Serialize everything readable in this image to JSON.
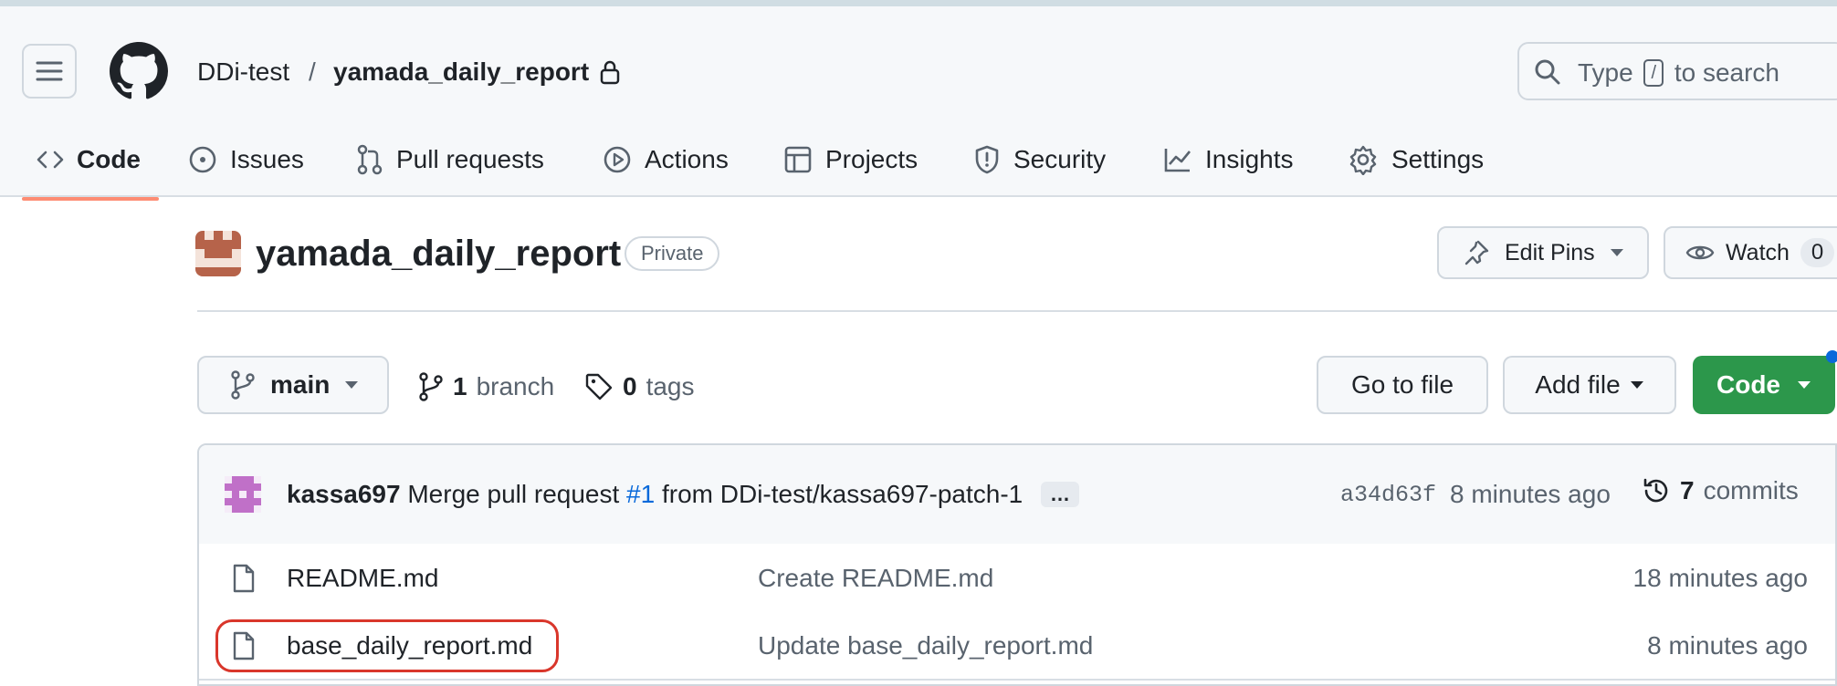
{
  "header": {
    "owner": "DDi-test",
    "separator": "/",
    "repo": "yamada_daily_report",
    "search": {
      "prefix": "Type",
      "key": "/",
      "suffix": "to search"
    }
  },
  "tabs": [
    {
      "label": "Code",
      "icon": "code-icon",
      "active": true
    },
    {
      "label": "Issues",
      "icon": "issue-circle-icon"
    },
    {
      "label": "Pull requests",
      "icon": "pull-request-icon"
    },
    {
      "label": "Actions",
      "icon": "play-icon"
    },
    {
      "label": "Projects",
      "icon": "table-icon"
    },
    {
      "label": "Security",
      "icon": "shield-icon"
    },
    {
      "label": "Insights",
      "icon": "graph-icon"
    },
    {
      "label": "Settings",
      "icon": "gear-icon"
    }
  ],
  "repo_header": {
    "title": "yamada_daily_report",
    "visibility": "Private",
    "edit_pins": "Edit Pins",
    "watch": "Watch",
    "watch_count": "0"
  },
  "toolbar": {
    "branch": "main",
    "branch_count": "1",
    "branch_label": "branch",
    "tag_count": "0",
    "tag_label": "tags",
    "go_to_file": "Go to file",
    "add_file": "Add file",
    "code": "Code"
  },
  "latest_commit": {
    "author": "kassa697",
    "message_prefix": "Merge pull request",
    "pr_link": "#1",
    "message_suffix": "from DDi-test/kassa697-patch-1",
    "ellipsis": "…",
    "sha": "a34d63f",
    "time": "8 minutes ago",
    "commit_count": "7",
    "commit_label": "commits"
  },
  "files": [
    {
      "name": "README.md",
      "commit": "Create README.md",
      "time": "18 minutes ago"
    },
    {
      "name": "base_daily_report.md",
      "commit": "Update base_daily_report.md",
      "time": "8 minutes ago",
      "highlighted": true
    }
  ],
  "colors": {
    "accent_underline": "#fd8c73",
    "primary_button": "#2c974b",
    "link": "#0969da",
    "highlight_ring": "#d9362b"
  }
}
